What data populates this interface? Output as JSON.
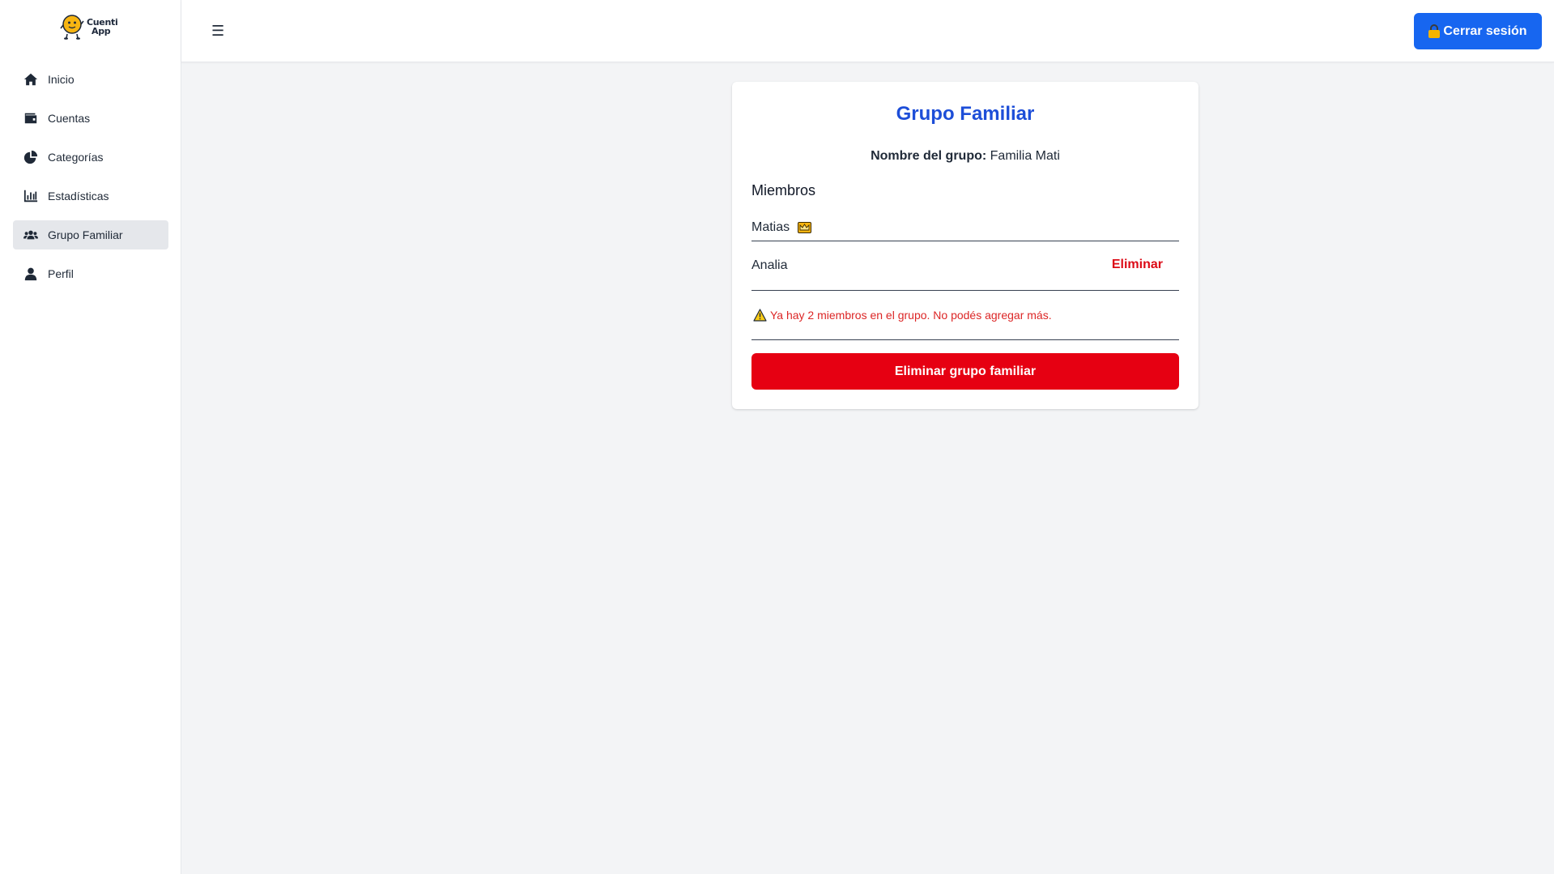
{
  "app": {
    "logo_line1": "Cuenti",
    "logo_line2": "App"
  },
  "sidebar": {
    "items": [
      {
        "label": "Inicio",
        "icon": "home-icon",
        "active": false
      },
      {
        "label": "Cuentas",
        "icon": "wallet-icon",
        "active": false
      },
      {
        "label": "Categorías",
        "icon": "pie-chart-icon",
        "active": false
      },
      {
        "label": "Estadísticas",
        "icon": "bar-chart-icon",
        "active": false
      },
      {
        "label": "Grupo Familiar",
        "icon": "users-icon",
        "active": true
      },
      {
        "label": "Perfil",
        "icon": "user-icon",
        "active": false
      }
    ]
  },
  "header": {
    "menu_glyph": "☰",
    "logout_label": "Cerrar sesión"
  },
  "card": {
    "title": "Grupo Familiar",
    "group_name_label": "Nombre del grupo:",
    "group_name_value": "Familia Mati",
    "members_title": "Miembros",
    "members": [
      {
        "name": "Matias",
        "is_owner": true
      },
      {
        "name": "Analia",
        "is_owner": false,
        "remove_label": "Eliminar"
      }
    ],
    "warning_text": "Ya hay 2 miembros en el grupo. No podés agregar más.",
    "delete_group_label": "Eliminar grupo familiar"
  },
  "colors": {
    "primary": "#1766f0",
    "title_blue": "#1d4ed8",
    "danger": "#e60012",
    "warning_text": "#dc2626"
  }
}
